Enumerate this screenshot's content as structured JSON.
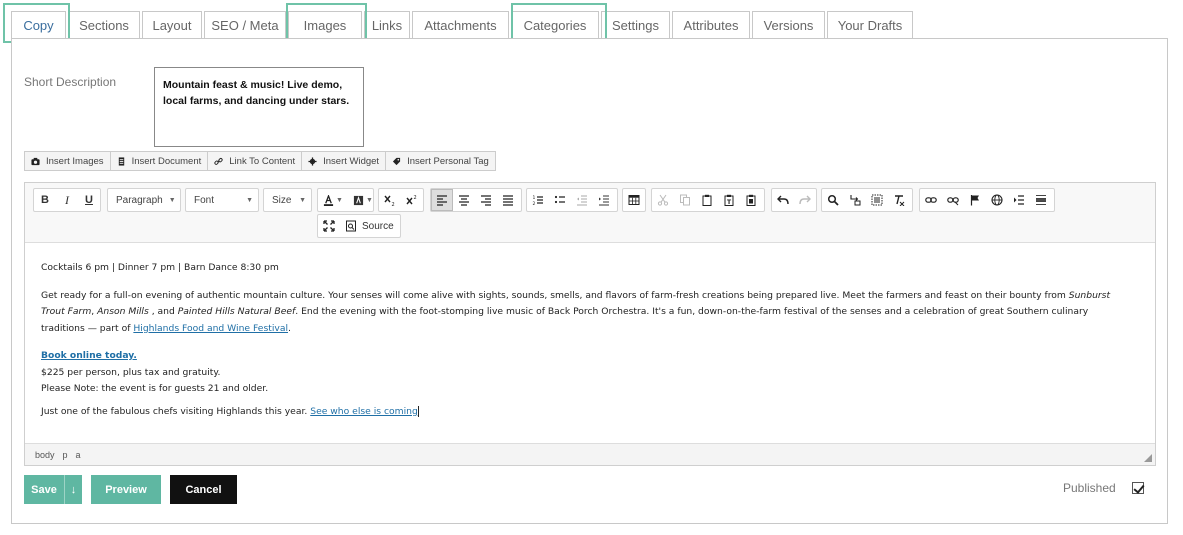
{
  "tabs": [
    {
      "label": "Copy"
    },
    {
      "label": "Sections"
    },
    {
      "label": "Layout"
    },
    {
      "label": "SEO / Meta"
    },
    {
      "label": "Images"
    },
    {
      "label": "Links"
    },
    {
      "label": "Attachments"
    },
    {
      "label": "Categories"
    },
    {
      "label": "Settings"
    },
    {
      "label": "Attributes"
    },
    {
      "label": "Versions"
    },
    {
      "label": "Your Drafts"
    }
  ],
  "active_tab": "Copy",
  "short_description": {
    "label": "Short Description",
    "value": "Mountain feast & music! Live demo, local farms, and dancing under stars."
  },
  "insert_bar": {
    "images": "Insert Images",
    "document": "Insert Document",
    "link": "Link To Content",
    "widget": "Insert Widget",
    "personal_tag": "Insert Personal Tag"
  },
  "toolbar": {
    "bold": "B",
    "italic": "I",
    "underline": "U",
    "paragraph": "Paragraph",
    "font": "Font",
    "size": "Size",
    "source": "Source"
  },
  "content": {
    "line1": "Cocktails 6 pm  |  Dinner 7 pm  |  Barn Dance 8:30 pm",
    "p2_a": "Get ready for a full-on evening of authentic mountain culture. Your senses will come alive with sights, sounds, smells, and flavors of farm-fresh creations being prepared live. Meet the farmers and feast on their bounty from ",
    "p2_em1": "Sunburst Trout Farm",
    "p2_b": ", ",
    "p2_em2": "Anson Mills",
    "p2_c": " , and ",
    "p2_em3": "Painted Hills Natural Beef",
    "p2_d": ". End the evening with the foot-stomping live music of Back Porch Orchestra. It's a fun, down-on-the-farm festival of the senses and a celebration of great Southern culinary traditions — part of ",
    "p2_link": "Highlands Food and Wine Festival",
    "p2_e": ".",
    "book_link": "Book online today.",
    "price": "$225 per person, plus tax and gratuity.",
    "note": "Please Note: the event is for guests 21 and older.",
    "last_a": "Just one of the fabulous chefs visiting Highlands this year. ",
    "last_link": "See who else is coming"
  },
  "statusbar": {
    "path": [
      "body",
      "p",
      "a"
    ]
  },
  "actions": {
    "save": "Save",
    "save_more": "↓",
    "preview": "Preview",
    "cancel": "Cancel"
  },
  "published": {
    "label": "Published",
    "checked": true
  },
  "colors": {
    "accent": "#5fb7a2",
    "highlight": "#6fc3a8",
    "link": "#1f6fa6"
  }
}
